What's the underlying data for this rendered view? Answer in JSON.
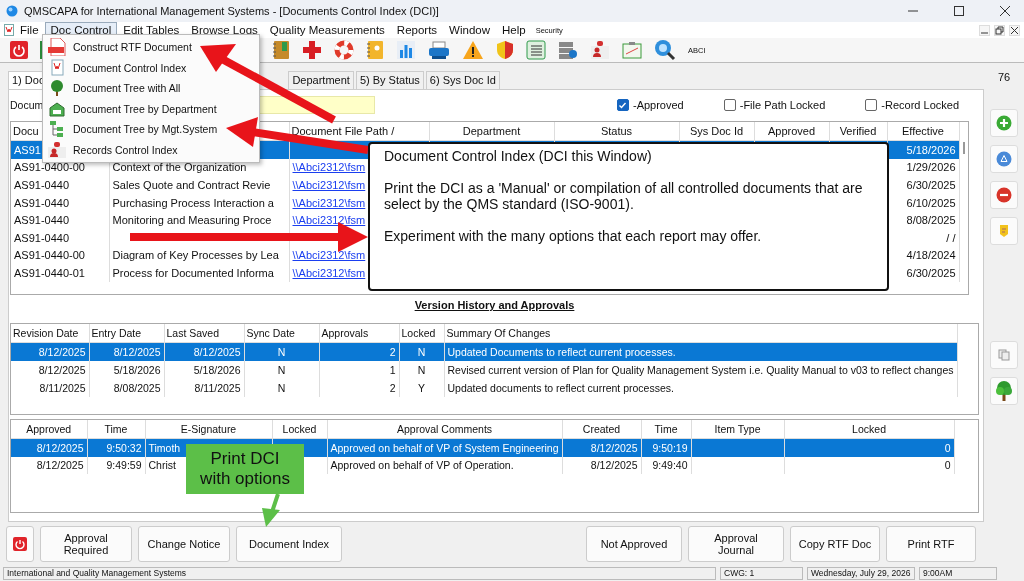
{
  "window": {
    "title": "QMSCAPA for International Management Systems - [Documents Control Index (DCI)]"
  },
  "menu": [
    {
      "label": "File",
      "selected": false
    },
    {
      "label": "Doc Control",
      "selected": true
    },
    {
      "label": "Edit Tables",
      "selected": false
    },
    {
      "label": "Browse Logs",
      "selected": false
    },
    {
      "label": "Quality Measurements",
      "selected": false
    },
    {
      "label": "Reports",
      "selected": false
    },
    {
      "label": "Window",
      "selected": false
    },
    {
      "label": "Help",
      "selected": false
    }
  ],
  "menu_security": "Security",
  "toolbar_label": "ABCI",
  "dropdown": [
    {
      "label": "Construct RTF Document",
      "kind": "rtf"
    },
    {
      "label": "Document Control Index",
      "kind": "doc"
    },
    {
      "label": "Document Tree with All",
      "kind": "tree"
    },
    {
      "label": "Document Tree by Department",
      "kind": "dept"
    },
    {
      "label": "Document Tree by Mgt.System",
      "kind": "mgt"
    },
    {
      "label": "Records Control Index",
      "kind": "records"
    }
  ],
  "tabs": [
    {
      "label": "1) Doc",
      "selected": true
    },
    {
      "label": "Department",
      "selected": false
    },
    {
      "label": "5) By Status",
      "selected": false
    },
    {
      "label": "6) Sys Doc Id",
      "selected": false
    }
  ],
  "count": "76",
  "filter": {
    "label": "Docum"
  },
  "checkboxes": [
    {
      "label": "-Approved",
      "checked": true
    },
    {
      "label": "-File Path Locked",
      "checked": false
    },
    {
      "label": "-Record Locked",
      "checked": false
    }
  ],
  "documents": {
    "columns": [
      {
        "label": "Docu"
      },
      {},
      {
        "label": "Document File Path /"
      },
      {
        "label": "Department"
      },
      {
        "label": "Status"
      },
      {
        "label": "Sys Doc Id"
      },
      {
        "label": "Approved"
      },
      {
        "label": "Verified"
      },
      {
        "label": "Effective"
      }
    ],
    "rows": [
      {
        "code": "AS91",
        "effective": "5/18/2026",
        "selected": true
      },
      {
        "code": "AS91-0400-00",
        "title": "Context of the Organization",
        "path": "\\\\Abci2312\\fsm",
        "effective": "1/29/2026",
        "selected": false
      },
      {
        "code": "AS91-0440",
        "title": "Sales Quote and Contract Revie",
        "path": "\\\\Abci2312\\fsm",
        "effective": "6/30/2025",
        "selected": false
      },
      {
        "code": "AS91-0440",
        "title": "Purchasing Process Interaction a",
        "path": "\\\\Abci2312\\fsm",
        "effective": "6/10/2025",
        "selected": false
      },
      {
        "code": "AS91-0440",
        "title": "Monitoring and Measuring Proce",
        "path": "\\\\Abci2312\\fsm",
        "effective": "8/08/2025",
        "selected": false
      },
      {
        "code": "AS91-0440",
        "effective": "/ /",
        "selected": false
      },
      {
        "code": "AS91-0440-00",
        "title": "Diagram of Key Processes by Lea",
        "path": "\\\\Abci2312\\fsm",
        "effective": "4/18/2024",
        "selected": false
      },
      {
        "code": "AS91-0440-01",
        "title": "Process for Documented Informa",
        "path": "\\\\Abci2312\\fsm",
        "effective": "6/30/2025",
        "selected": false
      }
    ]
  },
  "callout": {
    "title": "Document Control Index (DCI this Window)",
    "paragraphs": [
      "Print the DCI as a 'Manual' or compilation of all controlled documents that are select by the QMS standard (ISO-9001).",
      "Experiment with the many options that each report may offer."
    ]
  },
  "version_history": {
    "title": "Version History and Approvals",
    "columns": [
      "Revision Date",
      "Entry Date",
      "Last Saved",
      "Sync Date",
      "Approvals",
      "Locked",
      "Summary Of Changes"
    ],
    "rows": [
      {
        "cells": [
          "8/12/2025",
          "8/12/2025",
          "8/12/2025",
          "N",
          "2",
          "N",
          "Updated Documents to reflect current processes."
        ],
        "selected": true
      },
      {
        "cells": [
          "8/12/2025",
          "5/18/2026",
          "5/18/2026",
          "N",
          "1",
          "N",
          "Revised current version of Plan for Quality Management System i.e. Quality Manual to v03 to reflect changes"
        ],
        "selected": false
      },
      {
        "cells": [
          "8/11/2025",
          "8/08/2025",
          "8/11/2025",
          "N",
          "2",
          "Y",
          "Updated documents to reflect current processes."
        ],
        "selected": false
      }
    ]
  },
  "approvals": {
    "columns": [
      "Approved",
      "Time",
      "E-Signature",
      "Locked",
      "Approval Comments",
      "Created",
      "Time",
      "Item Type",
      "Locked"
    ],
    "rows": [
      {
        "cells": [
          "8/12/2025",
          "9:50:32",
          "Timoth",
          "",
          "Approved on behalf of VP of System Engineering",
          "8/12/2025",
          "9:50:19",
          "",
          "0"
        ],
        "selected": true
      },
      {
        "cells": [
          "8/12/2025",
          "9:49:59",
          "Christ",
          "",
          "Approved on behalf of VP of Operation.",
          "8/12/2025",
          "9:49:40",
          "",
          "0"
        ],
        "selected": false
      }
    ]
  },
  "green_callout": {
    "lines": [
      "Print DCI",
      "with options"
    ]
  },
  "buttons_left": [
    [
      "Approval",
      "Required"
    ],
    [
      "Change Notice"
    ],
    [
      "Document Index"
    ]
  ],
  "buttons_right": [
    "Not Approved",
    "Approval Journal",
    "Copy RTF Doc",
    "Print RTF"
  ],
  "status_bar": [
    "International and Quality Management Systems",
    "CWG: 1",
    "Wednesday, July 29, 2026",
    "9:00AM"
  ]
}
